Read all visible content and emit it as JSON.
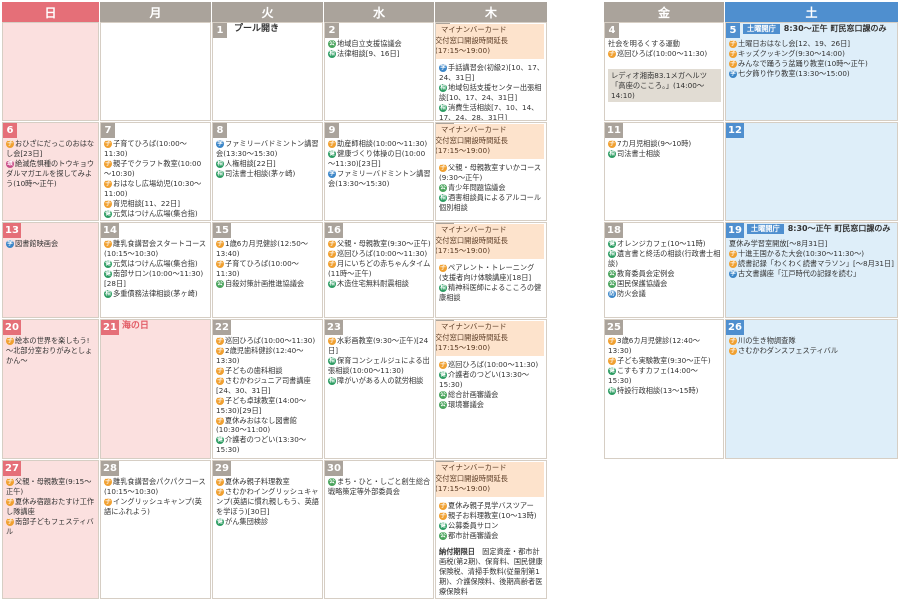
{
  "headers": [
    "日",
    "月",
    "火",
    "水",
    "木",
    "金",
    "土"
  ],
  "header_colors": [
    "#e56f78",
    "#aaa39b",
    "#aaa39b",
    "#aaa39b",
    "#aaa39b",
    "#aaa39b",
    "#4f8fcf"
  ],
  "mynumber": [
    "マイナンバーカード",
    "交付窓口開設時間延長",
    "(17:15～19:00)"
  ],
  "sat_notice": {
    "badge": "土曜開庁",
    "text": "8:30～正午 町民窓口課のみ"
  },
  "cells": {
    "d1": {
      "num": "1",
      "top": "プール開き",
      "events": []
    },
    "d2": {
      "num": "2",
      "events": [
        {
          "icon": "公",
          "text": "地域自立支援協議会"
        },
        {
          "icon": "相",
          "text": "法律相談[9、16日]"
        }
      ]
    },
    "d3": {
      "num": "3",
      "events": [
        {
          "icon": "学",
          "text": "手話講習会(初級2)[10、17、24、31日]"
        },
        {
          "icon": "相",
          "text": "地域包括支援センター出張相談[10、17、24、31日]"
        },
        {
          "icon": "相",
          "text": "消費生活相談[7、10、14、17、24、28、31日]"
        }
      ]
    },
    "d4": {
      "num": "4",
      "events": [
        {
          "icon": "",
          "text": "社会を明るくする運動"
        },
        {
          "icon": "子",
          "text": "巡回ひろば(10:00～11:30)"
        }
      ],
      "radio": "レディオ湘南83.1メガヘルツ「高座のこころ。」(14:00～14:10)"
    },
    "d5": {
      "num": "5",
      "events": [
        {
          "icon": "子",
          "text": "土曜日おはなし会[12、19、26日]"
        },
        {
          "icon": "子",
          "text": "キッズクッキング(9:30～14:00)"
        },
        {
          "icon": "子",
          "text": "みんなで踊ろう盆踊り教室(10時～正午)"
        },
        {
          "icon": "学",
          "text": "七夕飾り作り教室(13:30～15:00)"
        }
      ]
    },
    "d6": {
      "num": "6",
      "events": [
        {
          "icon": "子",
          "text": "おひざにだっこのおはなし会[23日]"
        },
        {
          "icon": "環",
          "text": "絶滅危惧種のトウキョウダルマガエルを探してみよう(10時～正午)"
        }
      ]
    },
    "d7": {
      "num": "7",
      "events": [
        {
          "icon": "子",
          "text": "子育てひろば(10:00～11:30)"
        },
        {
          "icon": "子",
          "text": "親子でクラフト教室(10:00～10:30)"
        },
        {
          "icon": "子",
          "text": "おはなし広場幼児(10:30～11:00)"
        },
        {
          "icon": "子",
          "text": "育児相談[11、22日]"
        },
        {
          "icon": "健",
          "text": "元気はつけん広場(集合指)[22、29日]"
        }
      ]
    },
    "d8": {
      "num": "8",
      "events": [
        {
          "icon": "学",
          "text": "ファミリーバドミントン講習会(13:30～15:30)"
        },
        {
          "icon": "相",
          "text": "人権相談[22日]"
        },
        {
          "icon": "相",
          "text": "司法書士相談(茅ヶ崎)"
        }
      ]
    },
    "d9": {
      "num": "9",
      "events": [
        {
          "icon": "子",
          "text": "助産師相談(10:00～11:30)"
        },
        {
          "icon": "健",
          "text": "健康づくり体操の日(10:00～11:30)[23日]"
        },
        {
          "icon": "学",
          "text": "ファミリーバドミントン講習会(13:30～15:30)"
        }
      ]
    },
    "d10": {
      "num": "10",
      "events": [
        {
          "icon": "子",
          "text": "父親・母親教室すいかコース(9:30～正午)"
        },
        {
          "icon": "公",
          "text": "青少年問題協議会"
        },
        {
          "icon": "相",
          "text": "酒害相談員によるアルコール個別相談"
        }
      ]
    },
    "d11": {
      "num": "11",
      "events": [
        {
          "icon": "子",
          "text": "7カ月児相談(9～10時)"
        },
        {
          "icon": "相",
          "text": "司法書士相談"
        }
      ]
    },
    "d12": {
      "num": "12",
      "events": []
    },
    "d13": {
      "num": "13",
      "events": [
        {
          "icon": "学",
          "text": "図書館映画会"
        }
      ]
    },
    "d14": {
      "num": "14",
      "events": [
        {
          "icon": "子",
          "text": "離乳食講習会スタートコース(10:15～10:30)"
        },
        {
          "icon": "健",
          "text": "元気はつけん広場(集合指)"
        },
        {
          "icon": "健",
          "text": "南部サロン(10:00～11:30)[28日]"
        },
        {
          "icon": "相",
          "text": "多重債務法律相談(茅ヶ崎)"
        }
      ]
    },
    "d15": {
      "num": "15",
      "events": [
        {
          "icon": "子",
          "text": "1歳6カ月児健診(12:50～13:40)"
        },
        {
          "icon": "子",
          "text": "子育てひろば(10:00～11:30)"
        },
        {
          "icon": "公",
          "text": "自殺対策計画推進協議会"
        }
      ]
    },
    "d16": {
      "num": "16",
      "events": [
        {
          "icon": "子",
          "text": "父親・母親教室(9:30～正午)"
        },
        {
          "icon": "子",
          "text": "巡回ひろば(10:00～11:30)"
        },
        {
          "icon": "子",
          "text": "月にいちどの赤ちゃんタイム(11時～正午)"
        },
        {
          "icon": "相",
          "text": "木造住宅無料耐震相談"
        }
      ]
    },
    "d17": {
      "num": "17",
      "events": [
        {
          "icon": "子",
          "text": "ペアレント・トレーニング(支援者向け体験講座)[18日]"
        },
        {
          "icon": "相",
          "text": "精神科医師によるこころの健康相談"
        }
      ]
    },
    "d18": {
      "num": "18",
      "events": [
        {
          "icon": "健",
          "text": "オレンジカフェ(10～11時)"
        },
        {
          "icon": "相",
          "text": "遺言書と終活の相談(行政書士相談)"
        },
        {
          "icon": "公",
          "text": "教育委員会定例会"
        },
        {
          "icon": "公",
          "text": "国民保護協議会"
        },
        {
          "icon": "防",
          "text": "防火会議"
        }
      ]
    },
    "d19": {
      "num": "19",
      "events": [
        {
          "icon": "",
          "text": "夏休み学習室開放[～8月31日]"
        },
        {
          "icon": "子",
          "text": "十進王国かるた大会(10:30～11:30～)"
        },
        {
          "icon": "子",
          "text": "読書記録「わくわく読書マラソン」[～8月31日]"
        },
        {
          "icon": "学",
          "text": "古文書講座「江戸時代の記録を読む」"
        }
      ]
    },
    "d20": {
      "num": "20",
      "events": [
        {
          "icon": "子",
          "text": "絵本の世界を楽しもう!～北部分室おりがみとしょかん～"
        }
      ]
    },
    "d21": {
      "num": "21",
      "top": "海の日",
      "events": []
    },
    "d22": {
      "num": "22",
      "events": [
        {
          "icon": "子",
          "text": "巡回ひろば(10:00～11:30)"
        },
        {
          "icon": "子",
          "text": "2歳児歯科健診(12:40～13:30)"
        },
        {
          "icon": "子",
          "text": "子どもの歯科相談"
        },
        {
          "icon": "子",
          "text": "さむかわジュニア司書講座[24、30、31日]"
        },
        {
          "icon": "子",
          "text": "子ども卓球教室(14:00～15:30)[29日]"
        },
        {
          "icon": "子",
          "text": "夏休みおはなし図書館(10:30～11:00)"
        },
        {
          "icon": "健",
          "text": "介護者のつどい(13:30～15:30)"
        }
      ]
    },
    "d23": {
      "num": "23",
      "events": [
        {
          "icon": "子",
          "text": "水彩画教室(9:30～正午)[24日]"
        },
        {
          "icon": "相",
          "text": "保育コンシェルジュによる出張相談(10:00～11:30)"
        },
        {
          "icon": "相",
          "text": "障がいがある人の就労相談"
        }
      ]
    },
    "d24": {
      "num": "24",
      "events": [
        {
          "icon": "子",
          "text": "巡回ひろば(10:00～11:30)"
        },
        {
          "icon": "健",
          "text": "介護者のつどい(13:30～15:30)"
        },
        {
          "icon": "公",
          "text": "総合計画審議会"
        },
        {
          "icon": "公",
          "text": "環境審議会"
        }
      ]
    },
    "d25": {
      "num": "25",
      "events": [
        {
          "icon": "子",
          "text": "3歳6カ月児健診(12:40～13:30)"
        },
        {
          "icon": "子",
          "text": "子ども実験教室(9:30～正午)"
        },
        {
          "icon": "健",
          "text": "こすもすカフェ(14:00～15:30)"
        },
        {
          "icon": "相",
          "text": "特設行政相談(13～15時)"
        }
      ]
    },
    "d26": {
      "num": "26",
      "events": [
        {
          "icon": "子",
          "text": "川の生き物調査隊"
        },
        {
          "icon": "子",
          "text": "さむかわダンスフェスティバル"
        }
      ]
    },
    "d27": {
      "num": "27",
      "events": [
        {
          "icon": "子",
          "text": "父親・母親教室(9:15～正午)"
        },
        {
          "icon": "子",
          "text": "夏休み宿題おたすけ工作し隊講座"
        },
        {
          "icon": "子",
          "text": "南部子どもフェスティバル"
        }
      ]
    },
    "d28": {
      "num": "28",
      "events": [
        {
          "icon": "子",
          "text": "離乳食講習会パクパクコース(10:15～10:30)"
        },
        {
          "icon": "子",
          "text": "イングリッシュキャンプ(英語にふれよう)"
        }
      ]
    },
    "d29": {
      "num": "29",
      "events": [
        {
          "icon": "子",
          "text": "夏休み親子料理教室"
        },
        {
          "icon": "子",
          "text": "さむかわイングリッシュキャンプ(英語に慣れ親しもう、英語を学ぼう)[30日]"
        },
        {
          "icon": "健",
          "text": "がん集団検診"
        }
      ]
    },
    "d30": {
      "num": "30",
      "events": [
        {
          "icon": "公",
          "text": "まち・ひと・しごと創生総合戦略策定等外部委員会"
        }
      ]
    },
    "d31": {
      "num": "31",
      "events": [
        {
          "icon": "子",
          "text": "夏休み親子見学バスツアー"
        },
        {
          "icon": "子",
          "text": "親子お料理教室(10～13時)"
        },
        {
          "icon": "健",
          "text": "公募委員サロン"
        },
        {
          "icon": "公",
          "text": "都市計画審議会"
        }
      ],
      "note_title": "納付期限日",
      "note": "固定資産・都市計画税(第2期)、保育料、国民健康保険税、清掃手数料(従量制第1期)、介護保険料、後期高齢者医療保険料"
    }
  }
}
